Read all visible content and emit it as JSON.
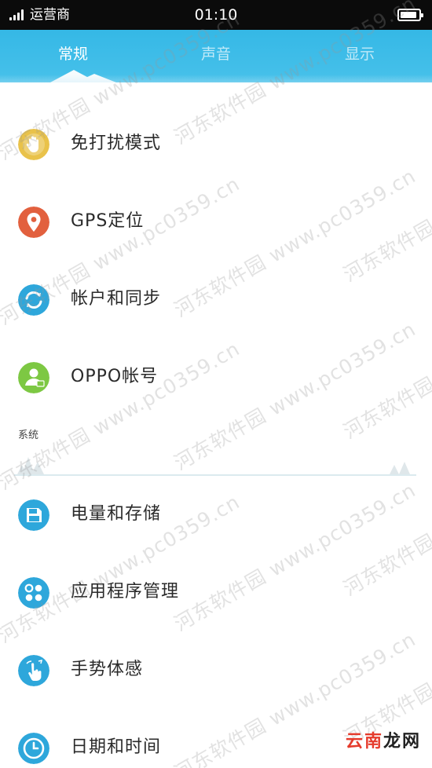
{
  "status_bar": {
    "carrier": "运营商",
    "time": "01:10",
    "signal_bars": 4,
    "battery_level": 0.9
  },
  "tabs": [
    {
      "label": "常规",
      "active": true
    },
    {
      "label": "声音",
      "active": false
    },
    {
      "label": "显示",
      "active": false
    }
  ],
  "general_items": [
    {
      "label": "免打扰模式",
      "icon": "hand-icon",
      "color": "#e9c24a"
    },
    {
      "label": "GPS定位",
      "icon": "location-pin-icon",
      "color": "#e2603e"
    },
    {
      "label": "帐户和同步",
      "icon": "sync-icon",
      "color": "#2ea7db"
    },
    {
      "label": "OPPO帐号",
      "icon": "account-icon",
      "color": "#7dc843"
    }
  ],
  "system_section": {
    "title": "系统",
    "items": [
      {
        "label": "电量和存储",
        "icon": "storage-icon",
        "color": "#2ea7db"
      },
      {
        "label": "应用程序管理",
        "icon": "apps-icon",
        "color": "#2ea7db"
      },
      {
        "label": "手势体感",
        "icon": "gesture-icon",
        "color": "#2ea7db"
      },
      {
        "label": "日期和时间",
        "icon": "clock-icon",
        "color": "#2ea7db"
      }
    ]
  },
  "colors": {
    "header": "#35b8e6",
    "status_bar": "#0b0b0b",
    "text": "#2a2a2a"
  },
  "watermark": {
    "site": "河东软件园",
    "url": "www.pc0359.cn"
  },
  "corner_logo": {
    "part1": "云南",
    "part2": "龙网"
  }
}
